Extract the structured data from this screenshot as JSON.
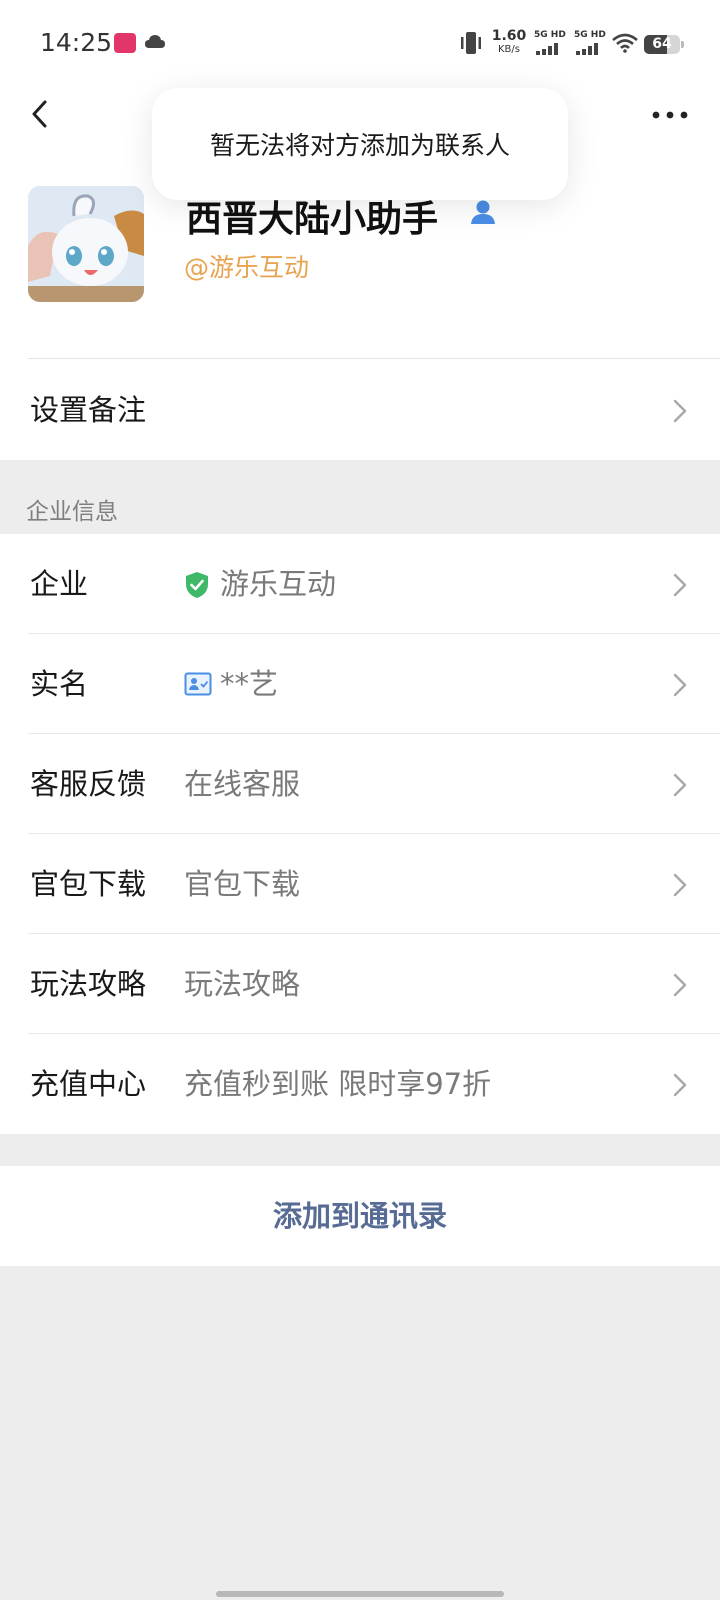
{
  "status_bar": {
    "time": "14:25",
    "speed_value": "1.60",
    "speed_unit": "KB/s",
    "sim1_label": "5G HD",
    "sim2_label": "5G HD",
    "battery_level": "64",
    "battery_fraction": 0.64
  },
  "header": {
    "back_icon": "chevron-left-icon",
    "more_icon": "more-dots-icon"
  },
  "toast": {
    "message": "暂无法将对方添加为联系人"
  },
  "profile": {
    "name": "西晋大陆小助手",
    "handle": "@游乐互动"
  },
  "remark_row": {
    "label": "设置备注"
  },
  "section": {
    "title": "企业信息"
  },
  "info_rows": [
    {
      "label": "企业",
      "value": "游乐互动",
      "icon": "shield-check-icon"
    },
    {
      "label": "实名",
      "value": "**艺",
      "icon": "id-card-icon"
    },
    {
      "label": "客服反馈",
      "value": "在线客服"
    },
    {
      "label": "官包下载",
      "value": "官包下载"
    },
    {
      "label": "玩法攻略",
      "value": "玩法攻略"
    },
    {
      "label": "充值中心",
      "value": "充值秒到账 限时享97折"
    }
  ],
  "actions": {
    "add_contact": "添加到通讯录"
  },
  "colors": {
    "link_blue": "#576b95",
    "handle_orange": "#e8a34f",
    "verified_green": "#3fb868",
    "background_gray": "#ededed"
  }
}
